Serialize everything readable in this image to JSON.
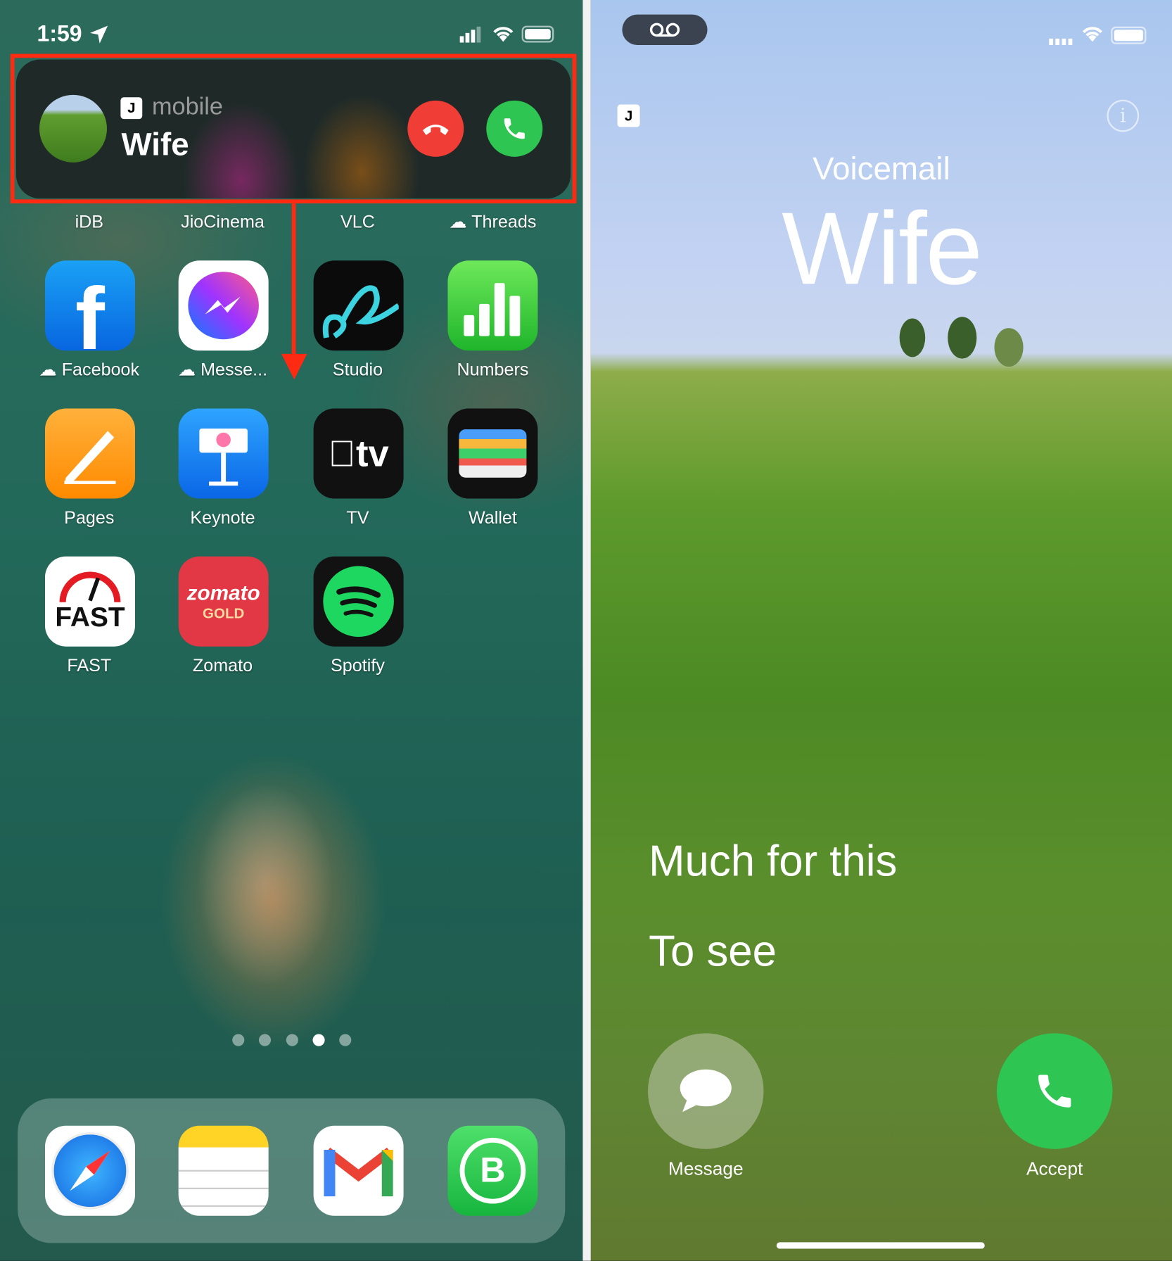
{
  "left_screen": {
    "status": {
      "time": "1:59",
      "icons": [
        "location-arrow-icon",
        "cellular-signal-icon",
        "wifi-icon",
        "battery-icon"
      ]
    },
    "call_banner": {
      "sim_badge": "J",
      "label": "mobile",
      "caller": "Wife",
      "decline_icon": "phone-down-icon",
      "accept_icon": "phone-icon"
    },
    "annotation": {
      "color": "#ff2a12"
    },
    "top_row_labels": [
      {
        "label": "iDB"
      },
      {
        "label": "JioCinema"
      },
      {
        "label": "VLC"
      },
      {
        "label": "Threads",
        "icloud": true
      }
    ],
    "apps": [
      {
        "label": "Facebook",
        "icloud": true
      },
      {
        "label": "Messe...",
        "icloud": true
      },
      {
        "label": "Studio"
      },
      {
        "label": "Numbers"
      },
      {
        "label": "Pages"
      },
      {
        "label": "Keynote"
      },
      {
        "label": "TV",
        "glyph": "tv"
      },
      {
        "label": "Wallet"
      },
      {
        "label": "FAST",
        "glyph": "FAST"
      },
      {
        "label": "Zomato",
        "glyph": "zomato",
        "glyph2": "GOLD"
      },
      {
        "label": "Spotify"
      }
    ],
    "page_dots": {
      "count": 5,
      "active": 4
    },
    "dock": [
      "Safari",
      "Notes",
      "Gmail",
      "WhatsApp Business"
    ]
  },
  "right_screen": {
    "status": {
      "icons": [
        "voicemail-icon",
        "cellular-signal-icon",
        "wifi-icon",
        "battery-icon"
      ]
    },
    "sim_badge": "J",
    "subtitle": "Voicemail",
    "caller": "Wife",
    "live_text": [
      "Much for this",
      "To see"
    ],
    "message_button": "Message",
    "accept_button": "Accept"
  }
}
